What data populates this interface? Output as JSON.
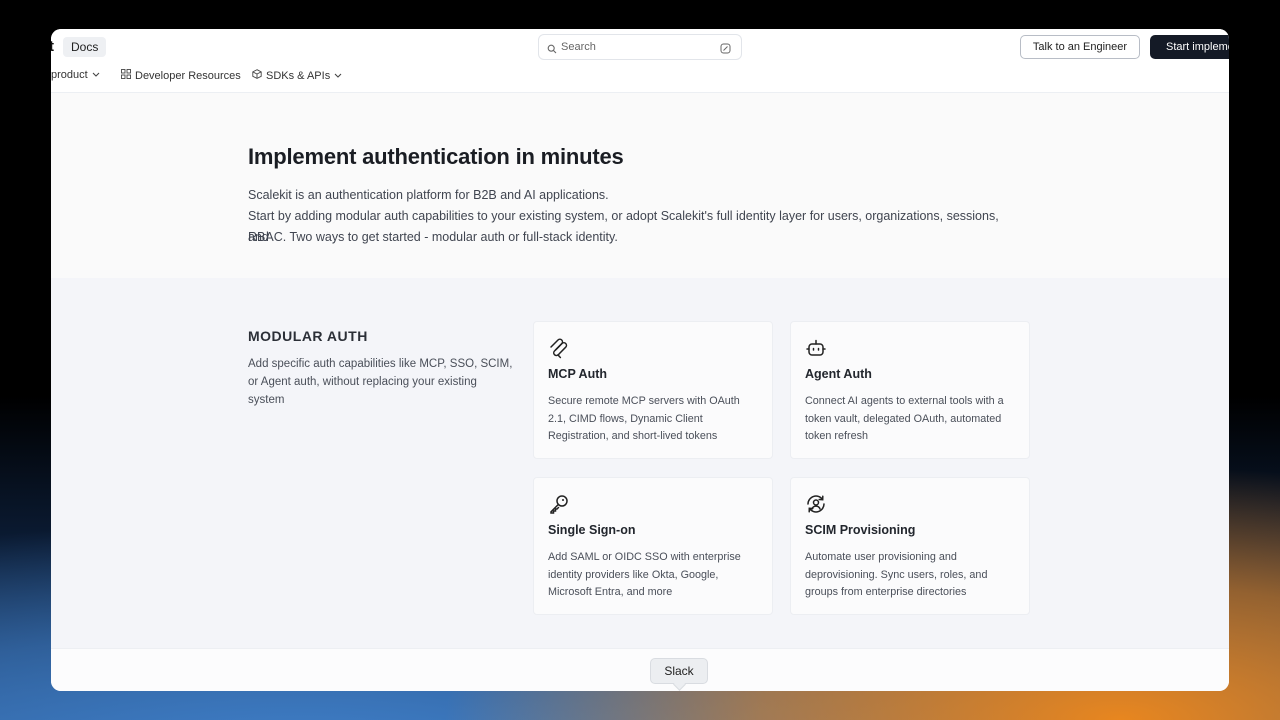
{
  "header": {
    "logo_fragment": "t",
    "docs_label": "Docs",
    "search_placeholder": "Search",
    "talk_button": "Talk to an Engineer",
    "start_button": "Start implementing"
  },
  "subnav": {
    "items": [
      {
        "label": "product",
        "icon": "chevron-down-icon"
      },
      {
        "label": "Developer Resources",
        "icon": "grid-icon"
      },
      {
        "label": "SDKs & APIs",
        "icon": "cube-icon"
      }
    ]
  },
  "hero": {
    "title": "Implement authentication in minutes",
    "line1": "Scalekit is an authentication platform for B2B and AI applications.",
    "line2": "Start by adding modular auth capabilities to your existing system, or adopt Scalekit's full identity layer for users, organizations, sessions, and",
    "line3": "RBAC. Two ways to get started - modular auth or full-stack identity."
  },
  "modular": {
    "title": "MODULAR AUTH",
    "description": "Add specific auth capabilities like MCP, SSO, SCIM, or Agent auth, without replacing your existing system",
    "cards": [
      {
        "icon": "mcp-icon",
        "title": "MCP Auth",
        "description": "Secure remote MCP servers with OAuth 2.1, CIMD flows, Dynamic Client Registration, and short-lived tokens"
      },
      {
        "icon": "robot-icon",
        "title": "Agent Auth",
        "description": "Connect AI agents to external tools with a token vault, delegated OAuth, automated token refresh"
      },
      {
        "icon": "key-icon",
        "title": "Single Sign-on",
        "description": "Add SAML or OIDC SSO with enterprise identity providers like Okta, Google, Microsoft Entra, and more"
      },
      {
        "icon": "user-sync-icon",
        "title": "SCIM Provisioning",
        "description": "Automate user provisioning and deprovisioning. Sync users, roles, and groups from enterprise directories"
      }
    ]
  },
  "tooltip": {
    "label": "Slack"
  },
  "colors": {
    "primary_button": "#141a26",
    "section_bg": "#f4f5f9",
    "text": "#1a1d23"
  }
}
